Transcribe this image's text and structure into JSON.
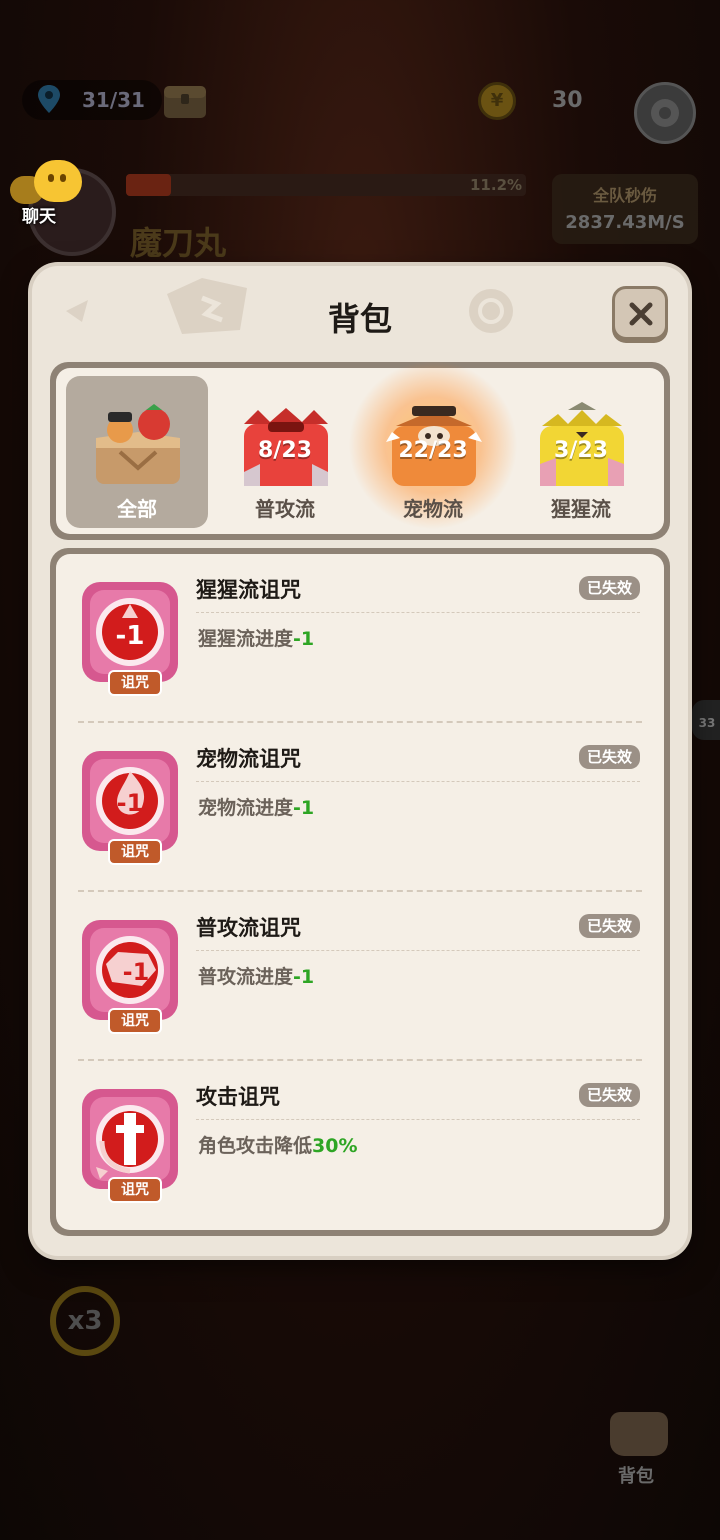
{
  "hud": {
    "stage_count": "31/31",
    "coin_count": "30",
    "chat_label": "聊天",
    "boss_name": "魔刀丸",
    "boss_hp_percent_text": "11.2%",
    "boss_hp_fraction": 0.112,
    "dps_label": "全队秒伤",
    "dps_value": "2837.43M/S",
    "speed_label": "x3",
    "bag_label": "背包",
    "side_counter": "33"
  },
  "modal": {
    "title": "背包",
    "tabs": [
      {
        "label": "全部",
        "count": "",
        "active": true,
        "icon": "all-items-chest-icon"
      },
      {
        "label": "普攻流",
        "count": "8/23",
        "active": false,
        "icon": "red-dragon-chest-icon",
        "color": "#e8423c"
      },
      {
        "label": "宠物流",
        "count": "22/23",
        "active": false,
        "icon": "boar-chest-icon",
        "color": "#ef8a3a",
        "highlighted": true
      },
      {
        "label": "猩猩流",
        "count": "3/23",
        "active": false,
        "icon": "ape-chest-icon",
        "color": "#f2d634"
      }
    ],
    "items": [
      {
        "name": "猩猩流诅咒",
        "status": "已失效",
        "tag": "诅咒",
        "desc_prefix": "猩猩流进度",
        "desc_value": "-1",
        "desc_suffix": "",
        "icon": "curse-minus-one-icon"
      },
      {
        "name": "宠物流诅咒",
        "status": "已失效",
        "tag": "诅咒",
        "desc_prefix": "宠物流进度",
        "desc_value": "-1",
        "desc_suffix": "",
        "icon": "curse-minus-one-flame-icon"
      },
      {
        "name": "普攻流诅咒",
        "status": "已失效",
        "tag": "诅咒",
        "desc_prefix": "普攻流进度",
        "desc_value": "-1",
        "desc_suffix": "",
        "icon": "curse-minus-one-dragon-icon"
      },
      {
        "name": "攻击诅咒",
        "status": "已失效",
        "tag": "诅咒",
        "desc_prefix": "角色攻击降低",
        "desc_value": "30",
        "desc_suffix": "%",
        "icon": "attack-down-icon"
      }
    ]
  },
  "colors": {
    "modal_bg": "#ece5da",
    "panel_bg": "#f5efe6",
    "frame": "#8e8275",
    "curse_frame": "#d6588f",
    "curse_core": "#d21c1c",
    "green_value": "#2ea524"
  }
}
